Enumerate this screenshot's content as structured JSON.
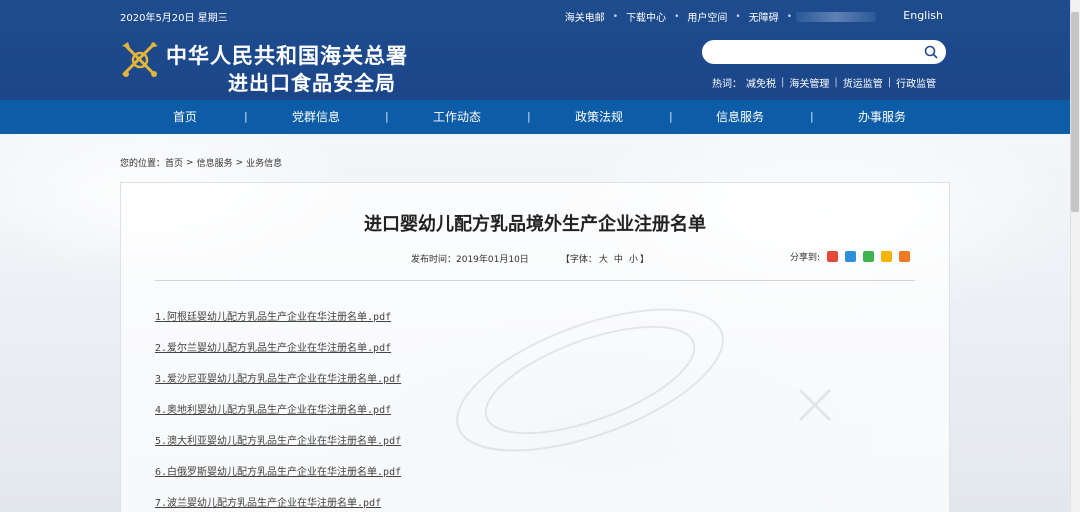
{
  "header": {
    "date": "2020年5月20日 星期三",
    "top_links": [
      "海关电邮",
      "下载中心",
      "用户空间",
      "无障碍"
    ],
    "english_label": "English",
    "title_line1": "中华人民共和国海关总署",
    "title_line2": "进出口食品安全局",
    "search_placeholder": "",
    "hotwords_label": "热词：",
    "hotwords": [
      "减免税",
      "海关管理",
      "货运监管",
      "行政监管"
    ]
  },
  "nav": {
    "items": [
      "首页",
      "党群信息",
      "工作动态",
      "政策法规",
      "信息服务",
      "办事服务"
    ],
    "separator": "|"
  },
  "breadcrumb": {
    "prefix": "您的位置：",
    "items": [
      "首页",
      "信息服务",
      "业务信息"
    ],
    "arrow": ">"
  },
  "article": {
    "title": "进口婴幼儿配方乳品境外生产企业注册名单",
    "publish_label": "发布时间：2019年01月10日",
    "font_label": "【字体：",
    "font_options": [
      "大",
      "中",
      "小"
    ],
    "font_close": "】",
    "share_label": "分享到:",
    "share_icons": [
      {
        "name": "weibo-icon",
        "color": "#e4493a"
      },
      {
        "name": "qq-icon",
        "color": "#2f8fd8"
      },
      {
        "name": "wechat-icon",
        "color": "#3fb34f"
      },
      {
        "name": "qzone-icon",
        "color": "#f4b400"
      },
      {
        "name": "more-share-icon",
        "color": "#f07a24"
      }
    ],
    "documents": [
      "1.阿根廷婴幼儿配方乳品生产企业在华注册名单.pdf",
      "2.爱尔兰婴幼儿配方乳品生产企业在华注册名单.pdf",
      "3.爱沙尼亚婴幼儿配方乳品生产企业在华注册名单.pdf",
      "4.奥地利婴幼儿配方乳品生产企业在华注册名单.pdf",
      "5.澳大利亚婴幼儿配方乳品生产企业在华注册名单.pdf",
      "6.白俄罗斯婴幼儿配方乳品生产企业在华注册名单.pdf",
      "7.波兰婴幼儿配方乳品生产企业在华注册名单.pdf"
    ]
  },
  "colors": {
    "header_bg": "#1f4c8f",
    "nav_bg": "#0d5ca8",
    "emblem_gold": "#e3b43a"
  }
}
